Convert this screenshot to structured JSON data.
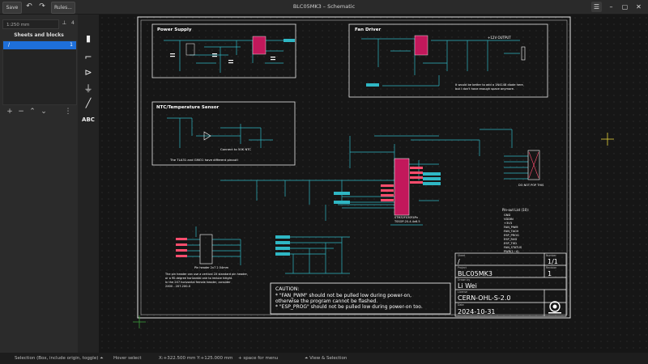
{
  "window": {
    "title": "BLC05MK3 – Schematic"
  },
  "toolbar": {
    "save_label": "Save",
    "undo_glyph": "↶",
    "redo_glyph": "↷",
    "rules_label": "Rules...",
    "hamburger_glyph": "☰",
    "minimize_glyph": "–",
    "maximize_glyph": "▢",
    "close_glyph": "✕"
  },
  "sidebar": {
    "zoom_value": "1:250 mm",
    "pin_glyph": "⟂",
    "count": "4",
    "panel_title": "Sheets and blocks",
    "sheet": {
      "name": "/",
      "number": "1"
    },
    "bar": {
      "add": "+",
      "remove": "−",
      "up": "⌃",
      "down": "⌄",
      "more": "⋮"
    }
  },
  "tools": {
    "component_glyph": "▮",
    "wire_glyph": "⌐",
    "label_glyph": "⊳",
    "power_glyph": "⏚",
    "line_glyph": "╱",
    "text_label": "ABC"
  },
  "schematic": {
    "blocks": {
      "power_supply": "Power Supply",
      "fan_driver": "Fan Driver",
      "ntc": "NTC/Temperature Sensor"
    },
    "fan_note_1": "It would be better to add a 1N4148 diode here,",
    "fan_note_2": "but I don't have enough space anymore.",
    "ntc_note_1": "Connect to 50K NTC",
    "ntc_note_2": "The TLA31 and GMO1 have different pinout!",
    "mcu_name": "STM32F030F4Px",
    "mcu_sub": "TSSOP-20-4.4x6.5",
    "fan_out": "+12V OUTPUT",
    "do_not_pop": "DO NOT POP THIS",
    "pin_header": "Pin header 2x7 2.54mm",
    "pinout_title": "Pin-out List (10):",
    "pinout_items": [
      "GND",
      "VDDIN",
      "+3V3",
      "FAN_PWM",
      "FAN_TACH",
      "ESP_PROG",
      "ESP_RXD",
      "ESP_TXD",
      "FAN_STATUS",
      "PWR(1~4)"
    ],
    "header_note_1": "The pin header can use a vertical 2X standard pin header,",
    "header_note_2": "or a 90-degree horizontal one to reduce height.",
    "header_note_3": "In the 2X7 horizontal female header, consider",
    "header_note_4": "2X00 - 2X7-2X0-0",
    "caution_title": "CAUTION:",
    "caution_1": "* \"FAN_PWM\" should not be pulled low during power-on,",
    "caution_2": "otherwise the program cannot be flashed.",
    "caution_3": "* \"ESP_PROG\" should not be pulled low during power-on too."
  },
  "title_block": {
    "sheet_label": "Sheet",
    "sheet_value": "/",
    "number_label": "Number",
    "number_value": "1/1",
    "project_label": "Project",
    "project_value": "BLC05MK3",
    "revision_label": "Revision",
    "revision_value": "1",
    "drawn_label": "Drawn by",
    "drawn_value": "Li Wei",
    "license_label": "License",
    "license_value": "CERN-OHL-S-2.0",
    "date_label": "Date",
    "date_value": "2024-10-31"
  },
  "statusbar": {
    "selection": "Selection (Box, include origin, toggle) ⏶",
    "hover": "Hover select",
    "coords": "X:+322.500 mm Y:+125.000 mm",
    "space": "+ space for menu",
    "view": "⏶ View & Selection"
  },
  "colors": {
    "wire": "#2fb7c4",
    "frame": "#e6e6e6",
    "pin_label": "#ff4d6d",
    "ic": "#c2185b",
    "cursor": "#e6d23a",
    "background": "#161616"
  }
}
